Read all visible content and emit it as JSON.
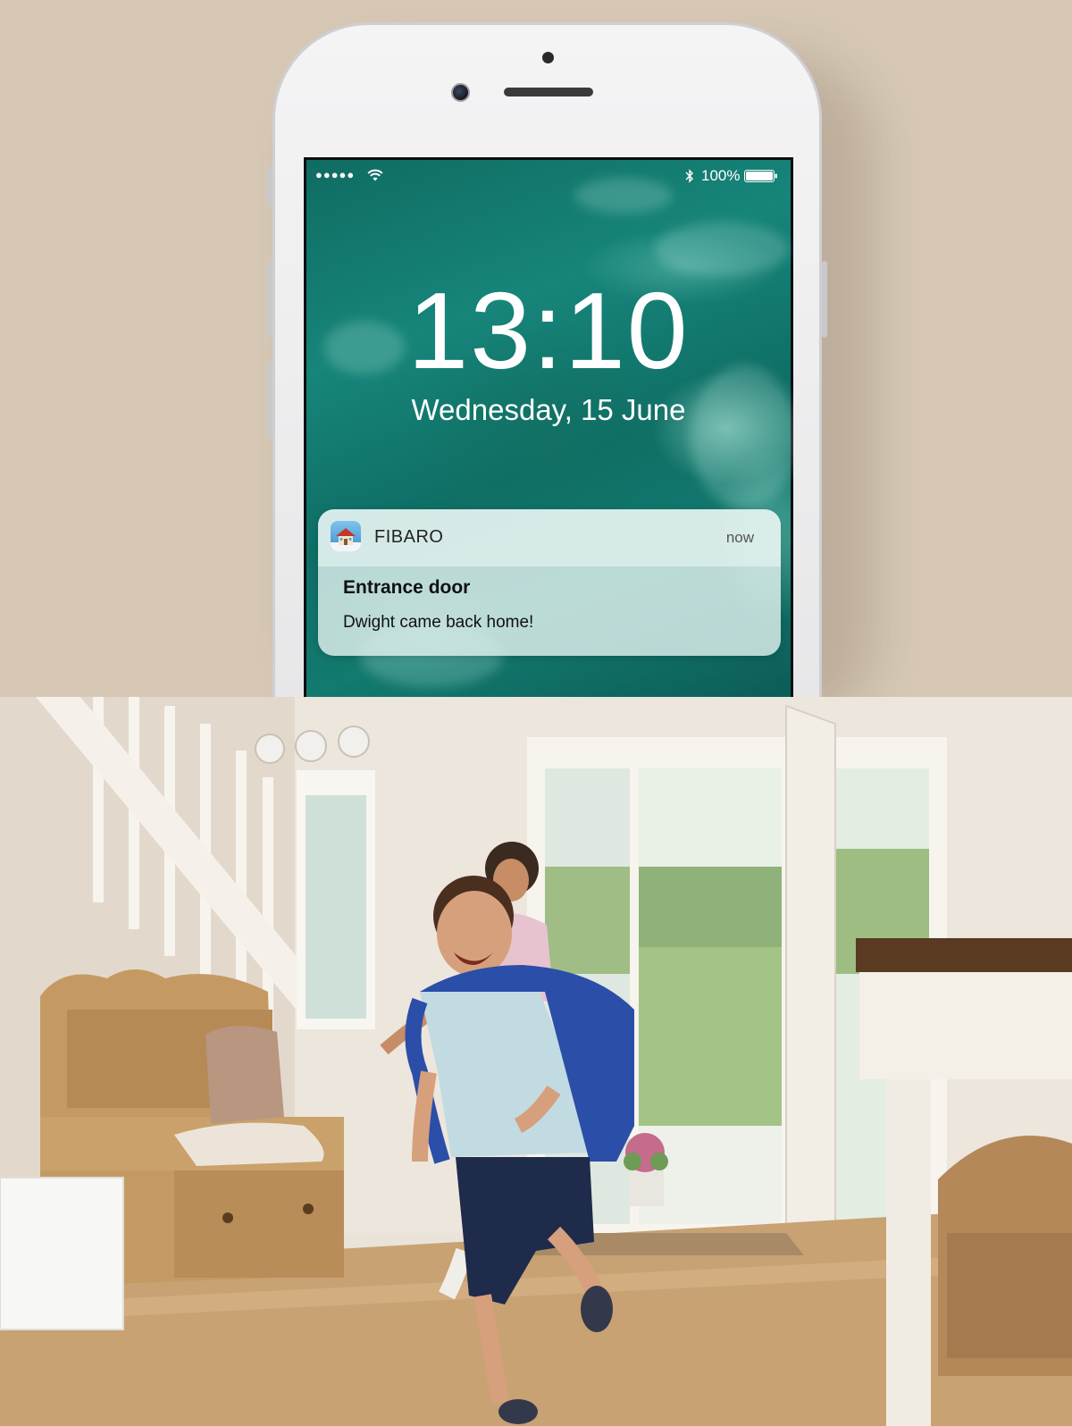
{
  "lockscreen": {
    "status": {
      "signal": "●●●●●",
      "battery_percent": "100%"
    },
    "time": "13:10",
    "date": "Wednesday, 15 June"
  },
  "notification": {
    "app_name": "FIBARO",
    "app_icon": "fibaro-house-icon",
    "time": "now",
    "title": "Entrance door",
    "body": "Dwight came back home!"
  },
  "colors": {
    "background": "#d6c8b5",
    "phone_body": "#f0f0f1",
    "wallpaper": "#137a6f"
  },
  "photo": {
    "subject": "hallway-photo"
  }
}
